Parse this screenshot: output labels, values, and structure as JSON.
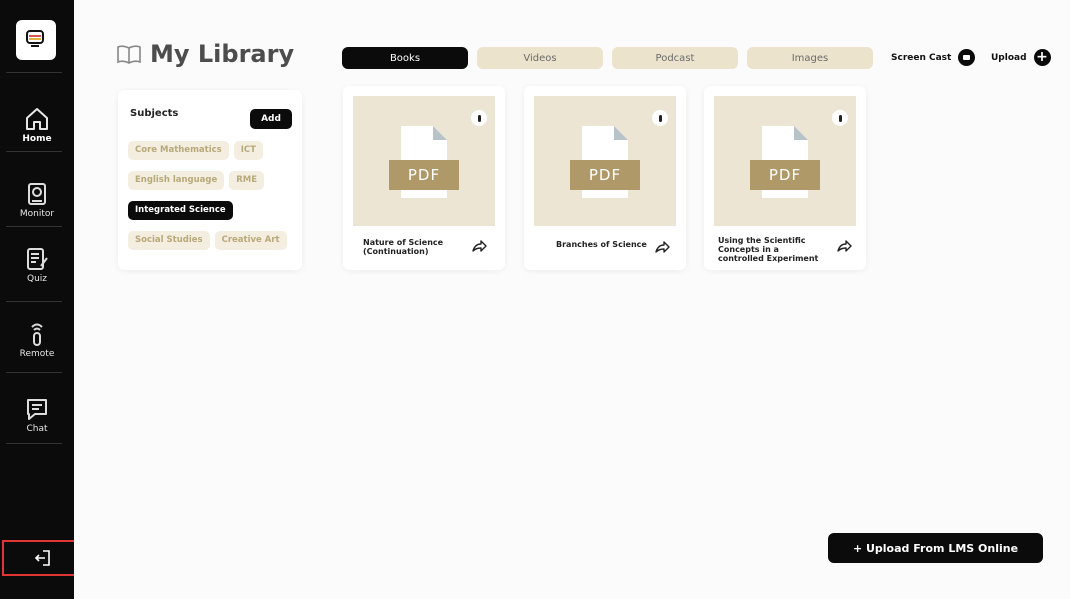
{
  "sidebar": {
    "items": [
      {
        "label": "Home",
        "icon": "home-icon"
      },
      {
        "label": "Monitor",
        "icon": "monitor-icon"
      },
      {
        "label": "Quiz",
        "icon": "quiz-icon"
      },
      {
        "label": "Remote",
        "icon": "remote-icon"
      },
      {
        "label": "Chat",
        "icon": "chat-icon"
      }
    ],
    "logout_icon": "logout-icon"
  },
  "header": {
    "title": "My Library",
    "icon": "book-icon"
  },
  "tabs": [
    {
      "label": "Books",
      "active": true
    },
    {
      "label": "Videos",
      "active": false
    },
    {
      "label": "Podcast",
      "active": false
    },
    {
      "label": "Images",
      "active": false
    }
  ],
  "actions": {
    "screen_cast": "Screen Cast",
    "upload": "Upload"
  },
  "subjects": {
    "heading": "Subjects",
    "add_label": "Add",
    "items": [
      {
        "label": "Core Mathematics",
        "active": false
      },
      {
        "label": "ICT",
        "active": false
      },
      {
        "label": "English language",
        "active": false
      },
      {
        "label": "RME",
        "active": false
      },
      {
        "label": "Integrated Science",
        "active": true
      },
      {
        "label": "Social Studies",
        "active": false
      },
      {
        "label": "Creative Art",
        "active": false
      }
    ]
  },
  "books": [
    {
      "title": "Nature of Science (Continuation)",
      "badge": "PDF"
    },
    {
      "title": "Branches of Science",
      "badge": "PDF"
    },
    {
      "title": "Using the Scientific Concepts in a controlled Experiment",
      "badge": "PDF"
    }
  ],
  "upload_lms_label": "+ Upload From LMS Online",
  "colors": {
    "accent_dark": "#0b0b0b",
    "chip_bg": "#f3eee0",
    "chip_text": "#b8a979",
    "pdf_badge": "#b09968",
    "highlight_box": "#e03636"
  }
}
